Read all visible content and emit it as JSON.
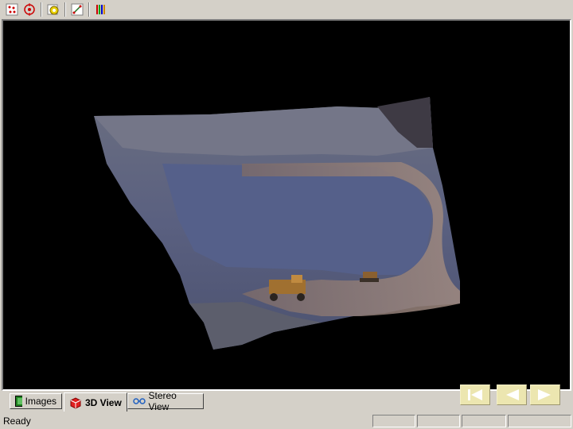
{
  "toolbar": {
    "buttons": [
      {
        "name": "points-tool",
        "icon": "points-icon"
      },
      {
        "name": "target-tool",
        "icon": "target-icon"
      },
      {
        "name": "camera-tool",
        "icon": "camera-icon"
      },
      {
        "name": "measure-tool",
        "icon": "measure-icon"
      },
      {
        "name": "color-bars-tool",
        "icon": "color-bars-icon"
      }
    ]
  },
  "tabs": [
    {
      "label": "Images",
      "icon": "images-icon"
    },
    {
      "label": "3D View",
      "icon": "cube-icon",
      "active": true
    },
    {
      "label": "Stereo View",
      "icon": "stereo-glasses-icon"
    }
  ],
  "status": {
    "text": "Ready"
  },
  "colors": {
    "chrome": "#d4d0c8",
    "viewport_bg": "#000000",
    "nav_button": "#ece6b0",
    "nav_arrow": "#ffffff"
  }
}
